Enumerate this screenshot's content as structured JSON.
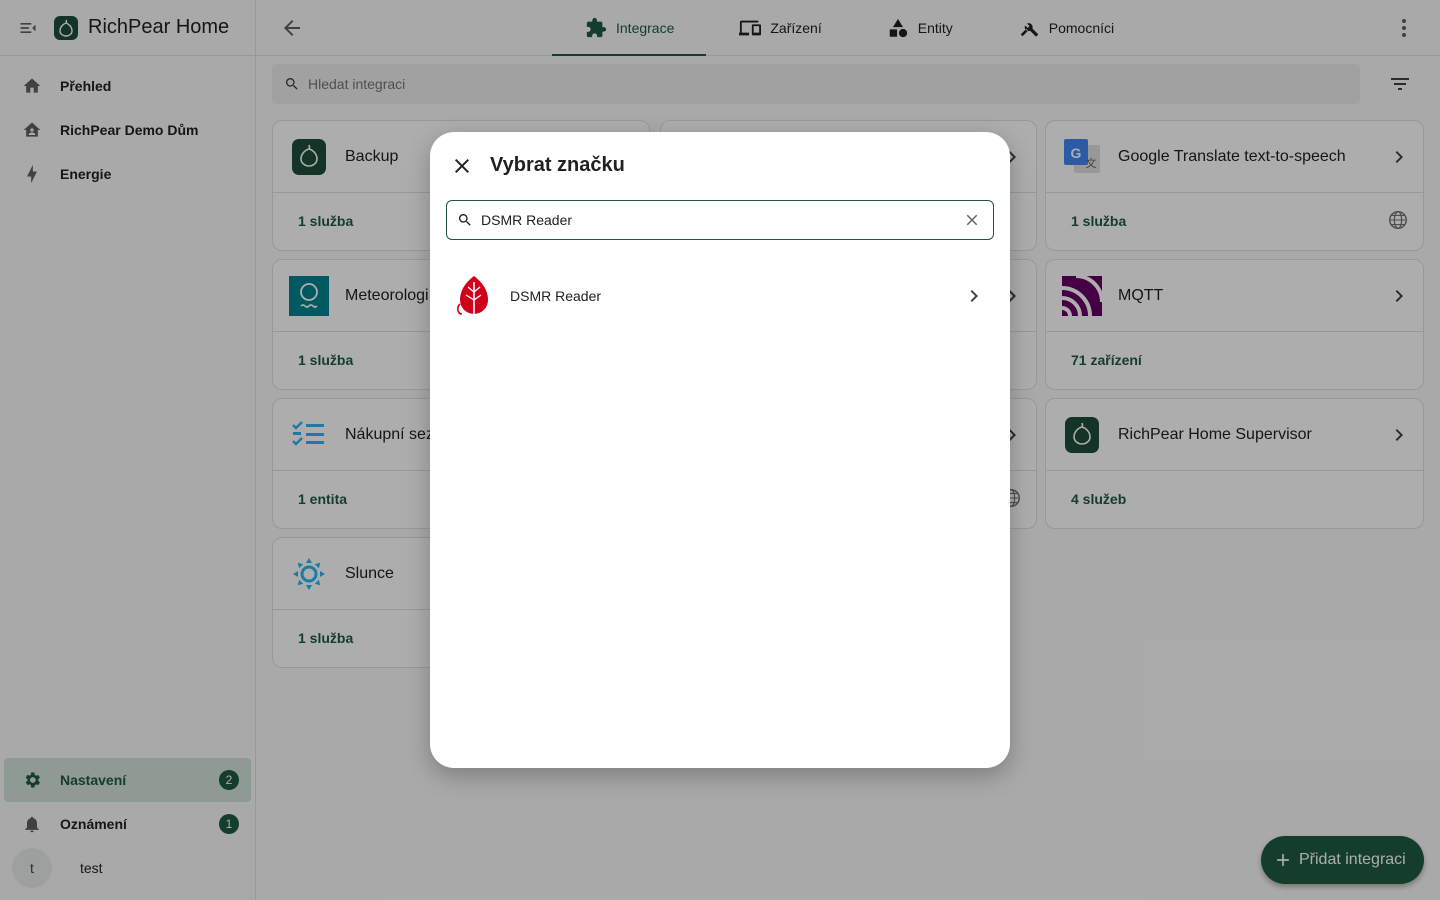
{
  "app": {
    "title": "RichPear Home"
  },
  "sidebar": {
    "items": [
      {
        "label": "Přehled",
        "icon": "home-icon"
      },
      {
        "label": "RichPear Demo Dům",
        "icon": "home-account-icon"
      },
      {
        "label": "Energie",
        "icon": "lightning-icon"
      }
    ],
    "bottom": [
      {
        "label": "Nastavení",
        "icon": "gear-icon",
        "badge": "2",
        "active": true
      },
      {
        "label": "Oznámení",
        "icon": "bell-icon",
        "badge": "1"
      }
    ],
    "user": {
      "initial": "t",
      "name": "test"
    }
  },
  "tabs": [
    {
      "label": "Integrace",
      "icon": "puzzle-icon",
      "active": true
    },
    {
      "label": "Zařízení",
      "icon": "devices-icon"
    },
    {
      "label": "Entity",
      "icon": "shapes-icon"
    },
    {
      "label": "Pomocníci",
      "icon": "tools-icon"
    }
  ],
  "search": {
    "placeholder": "Hledat integraci"
  },
  "cards": [
    {
      "name": "Backup",
      "count": "1 služba"
    },
    {
      "name": "Google Translate text-to-speech",
      "count": "1 služba"
    },
    {
      "name": "Meteorologi",
      "count": "1 služba"
    },
    {
      "name": "MQTT",
      "count": "71 zařízení"
    },
    {
      "name": "Nákupní sez",
      "count": "1 entita"
    },
    {
      "name": "RichPear Home Supervisor",
      "count": "4 služeb"
    },
    {
      "name": "Slunce",
      "count": "1 služba"
    }
  ],
  "fab": {
    "label": "Přidat integraci"
  },
  "dialog": {
    "title": "Vybrat značku",
    "search_value": "DSMR Reader",
    "results": [
      {
        "name": "DSMR Reader"
      }
    ]
  },
  "colors": {
    "primary": "#1e5a40",
    "scrim": "rgba(0,0,0,0.32)",
    "mqtt": "#660066",
    "dsmr": "#d0021b"
  }
}
